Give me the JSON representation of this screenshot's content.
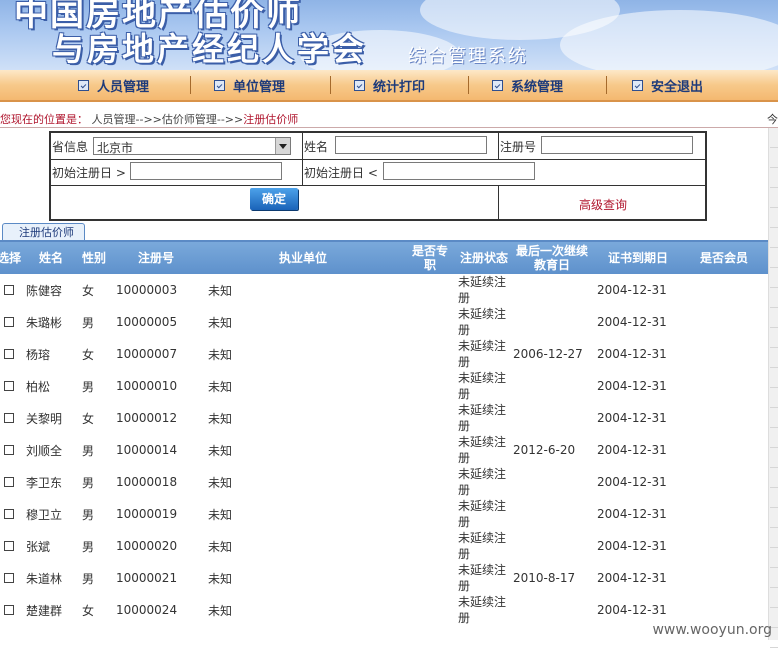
{
  "banner": {
    "line1": "中国房地产估价师",
    "line2": "与房地产经纪人学会",
    "subtitle": "综合管理系统"
  },
  "nav": {
    "items": [
      "人员管理",
      "单位管理",
      "统计打印",
      "系统管理",
      "安全退出"
    ]
  },
  "breadcrumb": {
    "label": "您现在的位置是：",
    "path": "人员管理-->>估价师管理-->>",
    "current": "注册估价师",
    "right_text": "今"
  },
  "search": {
    "province_label": "省信息",
    "province_value": "北京市",
    "name_label": "姓名",
    "name_value": "",
    "reg_no_label": "注册号",
    "reg_no_value": "",
    "init_reg_gt_label": "初始注册日 >",
    "init_reg_gt_value": "",
    "init_reg_lt_label": "初始注册日 <",
    "init_reg_lt_value": "",
    "confirm_label": "确定",
    "advanced_label": "高级查询"
  },
  "tab": {
    "label": "注册估价师"
  },
  "table": {
    "headers": {
      "select": "选择",
      "name": "姓名",
      "gender": "性别",
      "reg_no": "注册号",
      "unit": "执业单位",
      "fulltime": "是否专职",
      "status": "注册状态",
      "last_edu": "最后一次继续教育日",
      "cert_expiry": "证书到期日",
      "member": "是否会员"
    },
    "rows": [
      {
        "name": "陈健容",
        "gender": "女",
        "reg_no": "10000003",
        "unit": "未知",
        "status": "未延续注册",
        "last_edu": "",
        "cert_expiry": "2004-12-31"
      },
      {
        "name": "朱璐彬",
        "gender": "男",
        "reg_no": "10000005",
        "unit": "未知",
        "status": "未延续注册",
        "last_edu": "",
        "cert_expiry": "2004-12-31"
      },
      {
        "name": "杨瑢",
        "gender": "女",
        "reg_no": "10000007",
        "unit": "未知",
        "status": "未延续注册",
        "last_edu": "2006-12-27",
        "cert_expiry": "2004-12-31"
      },
      {
        "name": "柏松",
        "gender": "男",
        "reg_no": "10000010",
        "unit": "未知",
        "status": "未延续注册",
        "last_edu": "",
        "cert_expiry": "2004-12-31"
      },
      {
        "name": "关黎明",
        "gender": "女",
        "reg_no": "10000012",
        "unit": "未知",
        "status": "未延续注册",
        "last_edu": "",
        "cert_expiry": "2004-12-31"
      },
      {
        "name": "刘顺全",
        "gender": "男",
        "reg_no": "10000014",
        "unit": "未知",
        "status": "未延续注册",
        "last_edu": "2012-6-20",
        "cert_expiry": "2004-12-31"
      },
      {
        "name": "李卫东",
        "gender": "男",
        "reg_no": "10000018",
        "unit": "未知",
        "status": "未延续注册",
        "last_edu": "",
        "cert_expiry": "2004-12-31"
      },
      {
        "name": "穆卫立",
        "gender": "男",
        "reg_no": "10000019",
        "unit": "未知",
        "status": "未延续注册",
        "last_edu": "",
        "cert_expiry": "2004-12-31"
      },
      {
        "name": "张斌",
        "gender": "男",
        "reg_no": "10000020",
        "unit": "未知",
        "status": "未延续注册",
        "last_edu": "",
        "cert_expiry": "2004-12-31"
      },
      {
        "name": "朱道林",
        "gender": "男",
        "reg_no": "10000021",
        "unit": "未知",
        "status": "未延续注册",
        "last_edu": "2010-8-17",
        "cert_expiry": "2004-12-31"
      },
      {
        "name": "楚建群",
        "gender": "女",
        "reg_no": "10000024",
        "unit": "未知",
        "status": "未延续注册",
        "last_edu": "",
        "cert_expiry": "2004-12-31"
      }
    ]
  },
  "watermark": "www.wooyun.org",
  "colors": {
    "nav_bg": "#f7c98a",
    "header_blue": "#5e91cc",
    "accent_red": "#b0162e",
    "nav_text": "#1d3a7a"
  }
}
